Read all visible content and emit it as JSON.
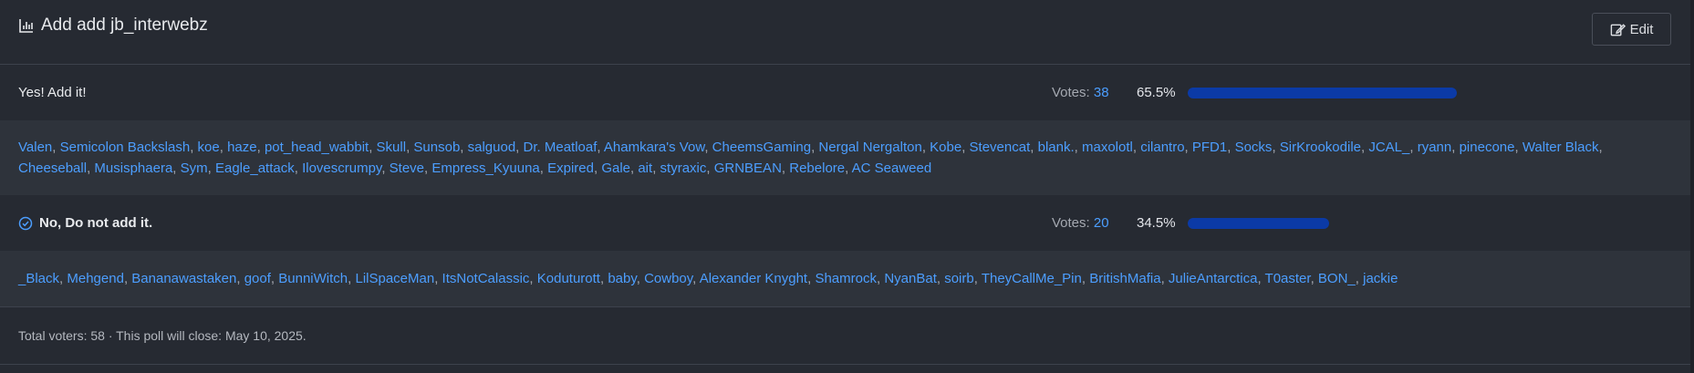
{
  "poll": {
    "title": "Add add jb_interwebz",
    "edit_label": "Edit",
    "votes_prefix": "Votes:",
    "options": [
      {
        "label": "Yes! Add it!",
        "votes": "38",
        "percent_text": "65.5%",
        "percent": 65.5,
        "selected": false,
        "voters": [
          "Valen",
          "Semicolon Backslash",
          "koe",
          "haze",
          "pot_head_wabbit",
          "Skull",
          "Sunsob",
          "salguod",
          "Dr. Meatloaf",
          "Ahamkara's Vow",
          "CheemsGaming",
          "Nergal Nergalton",
          "Kobe",
          "Stevencat",
          "blank.",
          "maxolotl",
          "cilantro",
          "PFD1",
          "Socks",
          "SirKrookodile",
          "JCAL_",
          "ryann",
          "pinecone",
          "Walter Black",
          "Cheeseball",
          "Musisphaera",
          "Sym",
          "Eagle_attack",
          "Ilovescrumpy",
          "Steve",
          "Empress_Kyuuna",
          "Expired",
          "Gale",
          "ait",
          "styraxic",
          "GRNBEAN",
          "Rebelore",
          "AC Seaweed"
        ]
      },
      {
        "label": "No, Do not add it.",
        "votes": "20",
        "percent_text": "34.5%",
        "percent": 34.5,
        "selected": true,
        "voters": [
          "_Black",
          "Mehgend",
          "Bananawastaken",
          "goof",
          "BunniWitch",
          "LilSpaceMan",
          "ItsNotCalassic",
          "Koduturott",
          "baby",
          "Cowboy",
          "Alexander Knyght",
          "Shamrock",
          "NyanBat",
          "soirb",
          "TheyCallMe_Pin",
          "BritishMafia",
          "JulieAntarctica",
          "T0aster",
          "BON_",
          "jackie"
        ]
      }
    ],
    "footer_text": "Total voters: 58 · This poll will close: May 10, 2025."
  },
  "colors": {
    "accent": "#4c9eff",
    "bar": "#0b3aa6",
    "background": "#262a32",
    "voters_bg": "#2e333b"
  },
  "icons": {
    "title": "bar-chart-icon",
    "edit": "edit-icon",
    "selected": "check-circle-icon"
  }
}
